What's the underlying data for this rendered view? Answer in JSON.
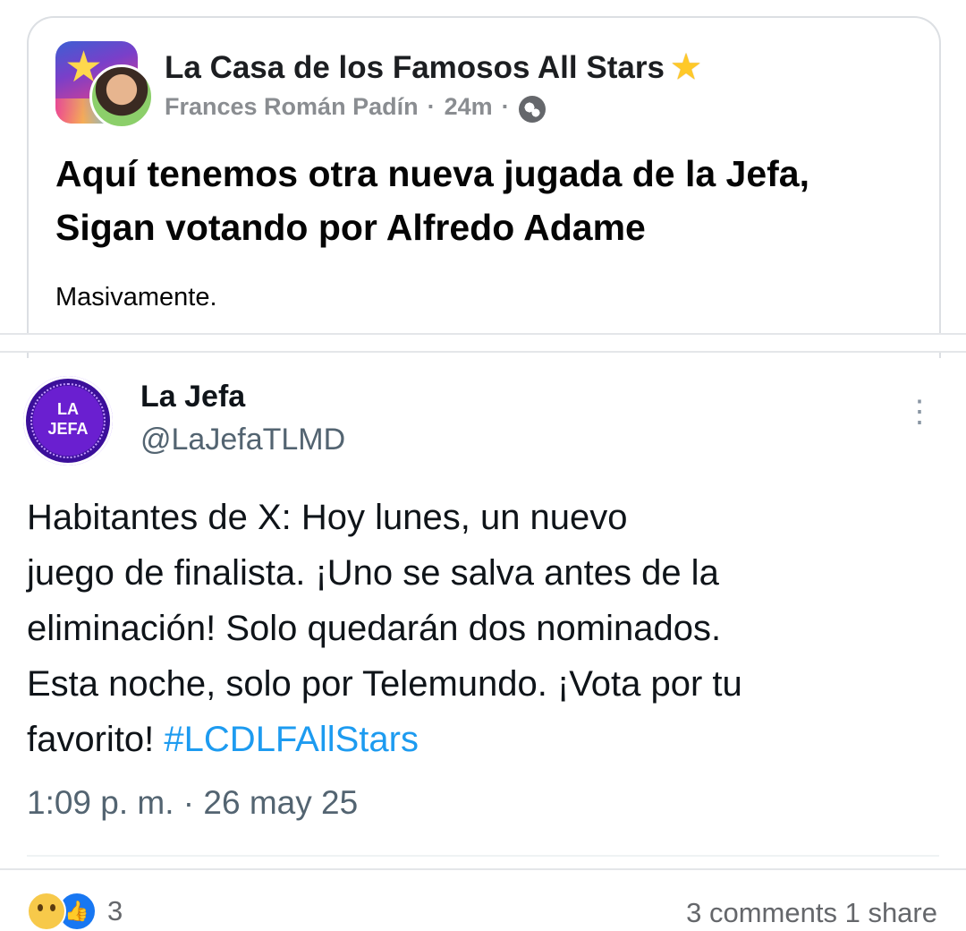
{
  "post": {
    "group_name": "La Casa de los Famosos All Stars",
    "author": "Frances Román Padín",
    "time": "24m",
    "separator": "·",
    "headline_line1": "Aquí tenemos otra nueva jugada de la Jefa,",
    "headline_line2": "Sigan votando por Alfredo Adame",
    "caption": "Masivamente."
  },
  "tweet": {
    "avatar_text_line1": "LA",
    "avatar_text_line2": "JEFA",
    "name": "La Jefa",
    "handle": "@LaJefaTLMD",
    "more_icon": "⋮",
    "text_line1": "Habitantes de X: Hoy lunes, un nuevo",
    "text_line2": "juego de finalista. ¡Uno se salva antes de la",
    "text_line3": "eliminación! Solo quedarán dos nominados.",
    "text_line4": "Esta noche, solo por Telemundo. ¡Vota por tu",
    "text_line5_start": "favorito!",
    "hashtag": "#LCDLFAllStars",
    "timestamp": "1:09 p. m. · 26 may 25"
  },
  "footer": {
    "reaction_count": "3",
    "comments_shares": "3 comments  1 share"
  },
  "icons": [
    "star-icon",
    "globe-icon",
    "more-options-icon",
    "wow-reaction-icon",
    "like-reaction-icon"
  ],
  "colors": {
    "hashtag": "#1d9bf0",
    "like_blue": "#1877f2",
    "meta_gray": "#8a8d91"
  }
}
